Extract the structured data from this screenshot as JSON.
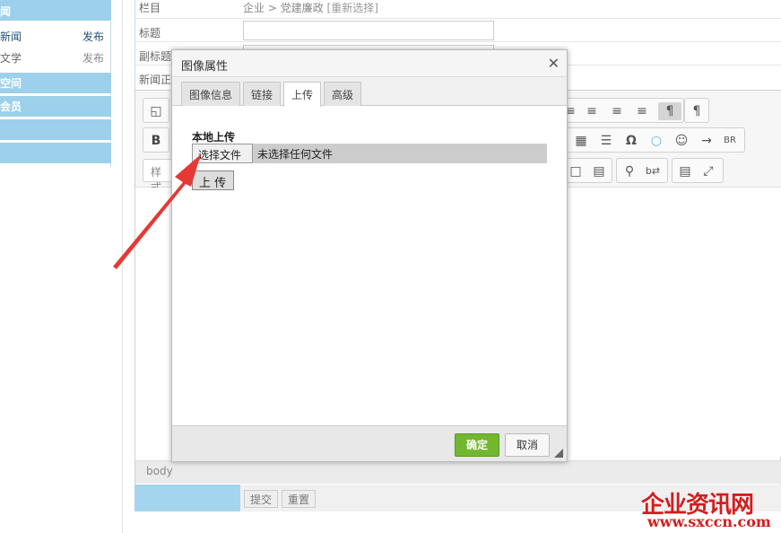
{
  "sidebar": {
    "top_label": "闻",
    "news_item": {
      "label": "新闻",
      "action": "发布"
    },
    "lit_item": {
      "label": "文学",
      "action": "发布"
    },
    "sections": [
      "空间",
      "会员",
      "",
      ""
    ]
  },
  "form": {
    "category": {
      "label": "栏目",
      "path": "企业 > 党建廉政",
      "reselect": "[重新选择]"
    },
    "title_label": "标题",
    "subtitle_label": "副标题",
    "body_label": "新闻正文",
    "style_box": "样式",
    "path_label": "body",
    "submit_label": "提交",
    "reset_label": "重置"
  },
  "toolbar_icons": [
    "align-left-icon",
    "align-center-icon",
    "align-right-icon",
    "justify-icon",
    "ltr-icon",
    "rtl-icon",
    "table-icon",
    "hr-icon",
    "omega-icon",
    "bubble-icon",
    "smiley-icon",
    "pagebreak-icon",
    "br-icon",
    "doc-icon",
    "doc2-icon",
    "search-icon",
    "replace-icon",
    "blocks-icon",
    "maximize-icon"
  ],
  "dialog": {
    "title": "图像属性",
    "tabs": [
      {
        "label": "图像信息"
      },
      {
        "label": "链接"
      },
      {
        "label": "上传",
        "active": true
      },
      {
        "label": "高级"
      }
    ],
    "section_title": "本地上传",
    "choose_label": "选择文件",
    "no_file_label": "未选择任何文件",
    "upload_label": "上 传",
    "ok_label": "确定",
    "cancel_label": "取消"
  },
  "watermark": {
    "line1": "企业资讯网",
    "line2": "www.sxccn.com"
  },
  "colors": {
    "sidebar": "#9dd0ea",
    "ok": "#72b82e",
    "arrow": "#e53935",
    "watermark": "#d31d1d"
  }
}
